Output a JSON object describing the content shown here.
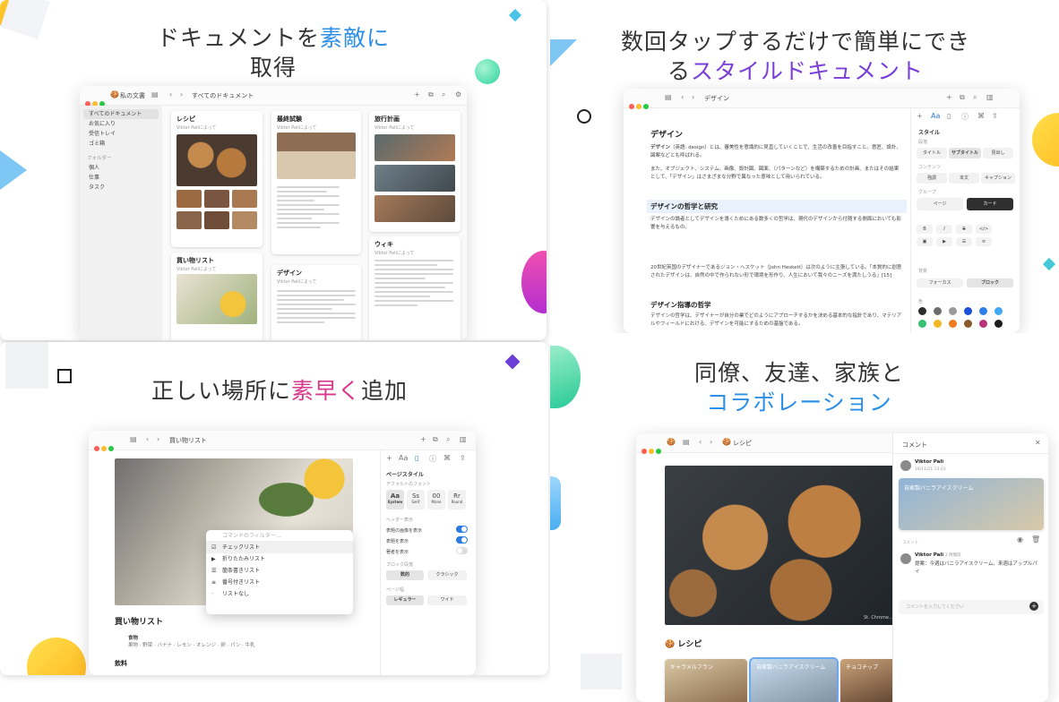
{
  "panels": [
    {
      "headline_parts": [
        "ドキュメントを",
        "素敵に",
        "取得"
      ],
      "window": {
        "app_title": "私の文書",
        "breadcrumb": "すべてのドキュメント",
        "sidebar": {
          "items": [
            "すべてのドキュメント",
            "お気に入り",
            "受信トレイ",
            "ゴミ箱"
          ],
          "folders_label": "フォルダー",
          "folders": [
            "個人",
            "仕事",
            "タスク"
          ]
        },
        "cards": [
          {
            "title": "レシピ",
            "author": "Viktor Paliによって"
          },
          {
            "title": "最終試験",
            "author": "Viktor Paliによって"
          },
          {
            "title": "旅行計画",
            "author": "Viktor Paliによって"
          },
          {
            "title": "買い物リスト",
            "author": "Viktor Paliによって"
          },
          {
            "title": "デザイン",
            "author": "Viktor Paliによって"
          },
          {
            "title": "ウィキ",
            "author": "Viktor Paliによって"
          }
        ]
      }
    },
    {
      "headline_parts": [
        "数回タップするだけで簡単にでき",
        "る",
        "スタイルドキュメント"
      ],
      "window": {
        "doc_title": "デザイン",
        "heading1": "デザイン",
        "para1_start": "デザイン",
        "para1_rest": "（英語: design）とは、審美性を意識的に見直していくことで、生活の改善を目指すこと。意匠、設計、図案などとも呼ばれる。",
        "para2": "また、オブジェクト、システム、画像、設計図、図面、（パターンなど）を構築するための計画、またはその結果として、「デザイン」はさまざまな分野で異なった意味として用いられている。",
        "heading2": "デザインの哲学と研究",
        "para3": "デザインの論者としてデザインを導くためにある数多くの哲学は、現代のデザインから付随する側面においても影響を与えるもの。",
        "para4": "20世紀英国のデザイナーであるジョン・ヘスケット（John Heskett）は次のように主張している。「本質的に創意されたデザインは、自然の中で作られない形で環境を形作り、人生において我々のニーズを満たしうる」[15]",
        "heading3": "デザイン指導の哲学",
        "para5": "デザインの哲学は、デザイナーが自分の業でどのようにアプローチするかを決める基本的な指針であり、マテリアルやフィールドにおける、デザインを可能にするための基盤である。",
        "inspector": {
          "section": "スタイル",
          "label_style": "段落",
          "styles": [
            "タイトル",
            "サブタイトル",
            "見出し"
          ],
          "label_content": "コンテンツ",
          "content": [
            "強調",
            "本文",
            "キャプション"
          ],
          "label_group": "グループ",
          "page_card": [
            "ページ",
            "カード"
          ],
          "label_block": "背景",
          "block": [
            "フォーカス",
            "ブロック"
          ],
          "label_color": "色",
          "colors": [
            "#2b2b2b",
            "#6d6d6d",
            "#9a9a9a",
            "#1d4fd8",
            "#2f7de8",
            "#3fa9f5",
            "#35c16f",
            "#f2b824",
            "#f07c1e",
            "#8a5a2b",
            "#b8337a",
            "#1c1c1c"
          ]
        }
      }
    },
    {
      "headline_parts": [
        "正しい場所に",
        "素早く",
        "追加"
      ],
      "window": {
        "doc_title": "買い物リスト",
        "page_heading": "買い物リスト",
        "subheading": "飲料",
        "row_label": "食物",
        "row_items": "果物 · 野菜 · バナナ · レモン · オレンジ · 卵 · パン · 牛乳",
        "popup": {
          "placeholder": "コマンドのフィルター…",
          "items": [
            "チェックリスト",
            "折りたたみリスト",
            "箇条書きリスト",
            "番号付きリスト",
            "リストなし"
          ]
        },
        "inspector": {
          "section": "ページスタイル",
          "label_font": "デフォルトのフォント",
          "fonts": [
            {
              "glyph": "Aa",
              "name": "System"
            },
            {
              "glyph": "Ss",
              "name": "Serif"
            },
            {
              "glyph": "00",
              "name": "Mono"
            },
            {
              "glyph": "Rr",
              "name": "Round"
            }
          ],
          "label_header": "ヘッダー表示",
          "toggles": [
            "表題の画像を表示",
            "表題を表示",
            "著者を表示"
          ],
          "label_block": "ブロック段落",
          "block": [
            "数的",
            "クラシック"
          ],
          "label_width": "ページ幅",
          "width": [
            "レギュラー",
            "ワイド"
          ]
        }
      }
    },
    {
      "headline_parts": [
        "同僚、友達、家族と",
        "コラボレーション"
      ],
      "window": {
        "doc_title": "レシピ",
        "photo_caption": "St. Chrome...",
        "doc_heading": "レシピ",
        "tiles": [
          "キャラメルフラン",
          "自家製バニラアイスクリーム",
          "チョコチップ"
        ],
        "comments": {
          "title": "コメント",
          "author1": "Viktor Pali",
          "time1": "16/11/21 13:03",
          "linked_card": "自家製バニラアイスクリーム",
          "label_comment": "コメント",
          "author2": "Viktor Pali",
          "time2": "2 時間前",
          "comment_text": "提案：今週はバニラアイスクリーム、来週はアップルパイ",
          "input_placeholder": "コメントを入力してください"
        }
      }
    }
  ]
}
